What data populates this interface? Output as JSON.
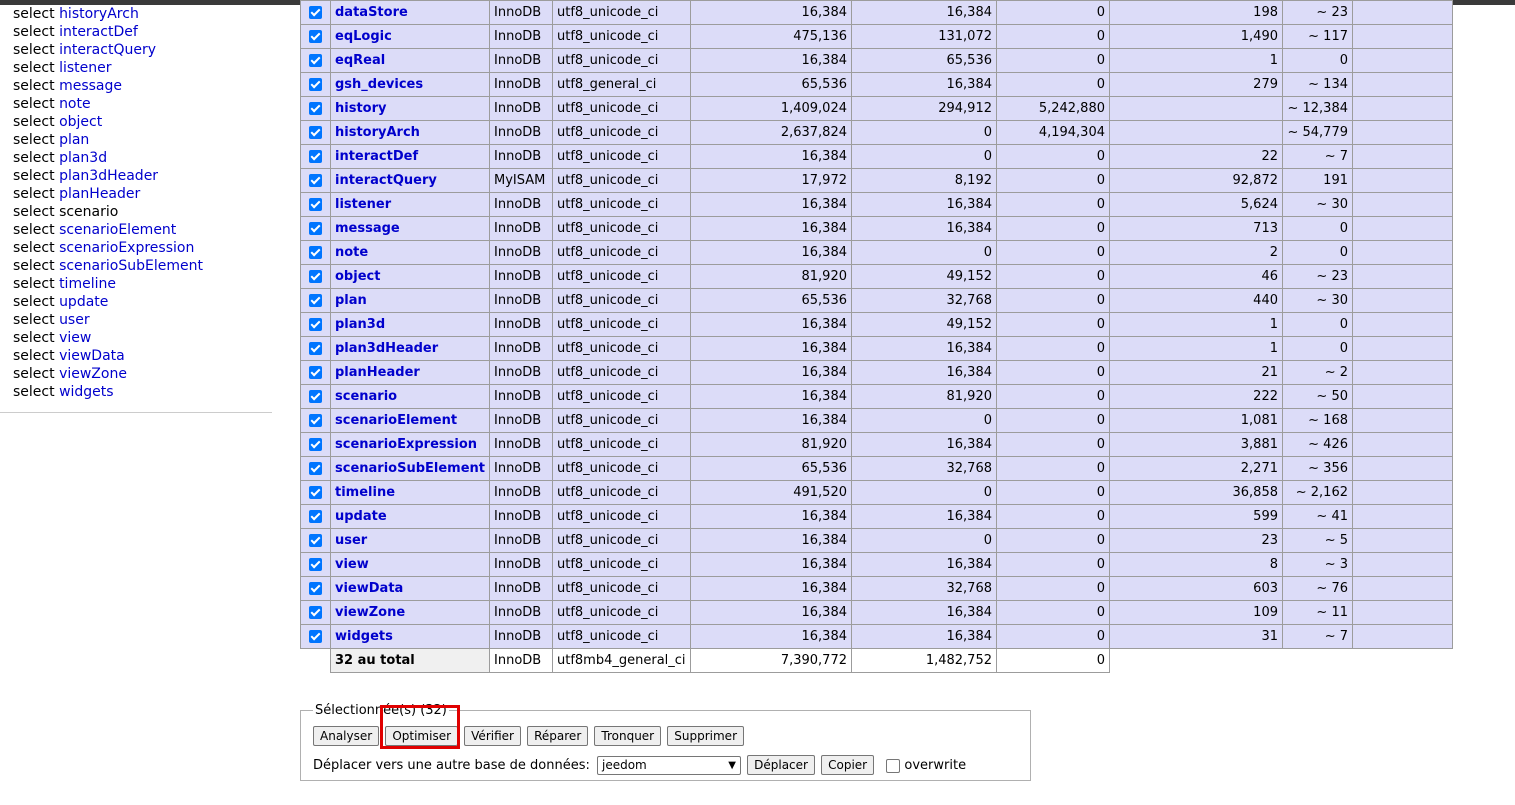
{
  "sidebar": {
    "keyword": "select",
    "items": [
      {
        "name": "historyArch",
        "active": false
      },
      {
        "name": "interactDef",
        "active": false
      },
      {
        "name": "interactQuery",
        "active": false
      },
      {
        "name": "listener",
        "active": false
      },
      {
        "name": "message",
        "active": false
      },
      {
        "name": "note",
        "active": false
      },
      {
        "name": "object",
        "active": false
      },
      {
        "name": "plan",
        "active": false
      },
      {
        "name": "plan3d",
        "active": false
      },
      {
        "name": "plan3dHeader",
        "active": false
      },
      {
        "name": "planHeader",
        "active": false
      },
      {
        "name": "scenario",
        "active": true
      },
      {
        "name": "scenarioElement",
        "active": false
      },
      {
        "name": "scenarioExpression",
        "active": false
      },
      {
        "name": "scenarioSubElement",
        "active": false
      },
      {
        "name": "timeline",
        "active": false
      },
      {
        "name": "update",
        "active": false
      },
      {
        "name": "user",
        "active": false
      },
      {
        "name": "view",
        "active": false
      },
      {
        "name": "viewData",
        "active": false
      },
      {
        "name": "viewZone",
        "active": false
      },
      {
        "name": "widgets",
        "active": false
      }
    ]
  },
  "tables": {
    "rows": [
      {
        "name": "dataStore",
        "engine": "InnoDB",
        "collation": "utf8_unicode_ci",
        "data_length": "16,384",
        "index_length": "16,384",
        "data_free": "0",
        "auto_increment": "198",
        "rows": "~ 23"
      },
      {
        "name": "eqLogic",
        "engine": "InnoDB",
        "collation": "utf8_unicode_ci",
        "data_length": "475,136",
        "index_length": "131,072",
        "data_free": "0",
        "auto_increment": "1,490",
        "rows": "~ 117"
      },
      {
        "name": "eqReal",
        "engine": "InnoDB",
        "collation": "utf8_unicode_ci",
        "data_length": "16,384",
        "index_length": "65,536",
        "data_free": "0",
        "auto_increment": "1",
        "rows": "0"
      },
      {
        "name": "gsh_devices",
        "engine": "InnoDB",
        "collation": "utf8_general_ci",
        "data_length": "65,536",
        "index_length": "16,384",
        "data_free": "0",
        "auto_increment": "279",
        "rows": "~ 134"
      },
      {
        "name": "history",
        "engine": "InnoDB",
        "collation": "utf8_unicode_ci",
        "data_length": "1,409,024",
        "index_length": "294,912",
        "data_free": "5,242,880",
        "auto_increment": "",
        "rows": "~ 12,384"
      },
      {
        "name": "historyArch",
        "engine": "InnoDB",
        "collation": "utf8_unicode_ci",
        "data_length": "2,637,824",
        "index_length": "0",
        "data_free": "4,194,304",
        "auto_increment": "",
        "rows": "~ 54,779"
      },
      {
        "name": "interactDef",
        "engine": "InnoDB",
        "collation": "utf8_unicode_ci",
        "data_length": "16,384",
        "index_length": "0",
        "data_free": "0",
        "auto_increment": "22",
        "rows": "~ 7"
      },
      {
        "name": "interactQuery",
        "engine": "MyISAM",
        "collation": "utf8_unicode_ci",
        "data_length": "17,972",
        "index_length": "8,192",
        "data_free": "0",
        "auto_increment": "92,872",
        "rows": "191"
      },
      {
        "name": "listener",
        "engine": "InnoDB",
        "collation": "utf8_unicode_ci",
        "data_length": "16,384",
        "index_length": "16,384",
        "data_free": "0",
        "auto_increment": "5,624",
        "rows": "~ 30"
      },
      {
        "name": "message",
        "engine": "InnoDB",
        "collation": "utf8_unicode_ci",
        "data_length": "16,384",
        "index_length": "16,384",
        "data_free": "0",
        "auto_increment": "713",
        "rows": "0"
      },
      {
        "name": "note",
        "engine": "InnoDB",
        "collation": "utf8_unicode_ci",
        "data_length": "16,384",
        "index_length": "0",
        "data_free": "0",
        "auto_increment": "2",
        "rows": "0"
      },
      {
        "name": "object",
        "engine": "InnoDB",
        "collation": "utf8_unicode_ci",
        "data_length": "81,920",
        "index_length": "49,152",
        "data_free": "0",
        "auto_increment": "46",
        "rows": "~ 23"
      },
      {
        "name": "plan",
        "engine": "InnoDB",
        "collation": "utf8_unicode_ci",
        "data_length": "65,536",
        "index_length": "32,768",
        "data_free": "0",
        "auto_increment": "440",
        "rows": "~ 30"
      },
      {
        "name": "plan3d",
        "engine": "InnoDB",
        "collation": "utf8_unicode_ci",
        "data_length": "16,384",
        "index_length": "49,152",
        "data_free": "0",
        "auto_increment": "1",
        "rows": "0"
      },
      {
        "name": "plan3dHeader",
        "engine": "InnoDB",
        "collation": "utf8_unicode_ci",
        "data_length": "16,384",
        "index_length": "16,384",
        "data_free": "0",
        "auto_increment": "1",
        "rows": "0"
      },
      {
        "name": "planHeader",
        "engine": "InnoDB",
        "collation": "utf8_unicode_ci",
        "data_length": "16,384",
        "index_length": "16,384",
        "data_free": "0",
        "auto_increment": "21",
        "rows": "~ 2"
      },
      {
        "name": "scenario",
        "engine": "InnoDB",
        "collation": "utf8_unicode_ci",
        "data_length": "16,384",
        "index_length": "81,920",
        "data_free": "0",
        "auto_increment": "222",
        "rows": "~ 50"
      },
      {
        "name": "scenarioElement",
        "engine": "InnoDB",
        "collation": "utf8_unicode_ci",
        "data_length": "16,384",
        "index_length": "0",
        "data_free": "0",
        "auto_increment": "1,081",
        "rows": "~ 168"
      },
      {
        "name": "scenarioExpression",
        "engine": "InnoDB",
        "collation": "utf8_unicode_ci",
        "data_length": "81,920",
        "index_length": "16,384",
        "data_free": "0",
        "auto_increment": "3,881",
        "rows": "~ 426"
      },
      {
        "name": "scenarioSubElement",
        "engine": "InnoDB",
        "collation": "utf8_unicode_ci",
        "data_length": "65,536",
        "index_length": "32,768",
        "data_free": "0",
        "auto_increment": "2,271",
        "rows": "~ 356"
      },
      {
        "name": "timeline",
        "engine": "InnoDB",
        "collation": "utf8_unicode_ci",
        "data_length": "491,520",
        "index_length": "0",
        "data_free": "0",
        "auto_increment": "36,858",
        "rows": "~ 2,162"
      },
      {
        "name": "update",
        "engine": "InnoDB",
        "collation": "utf8_unicode_ci",
        "data_length": "16,384",
        "index_length": "16,384",
        "data_free": "0",
        "auto_increment": "599",
        "rows": "~ 41"
      },
      {
        "name": "user",
        "engine": "InnoDB",
        "collation": "utf8_unicode_ci",
        "data_length": "16,384",
        "index_length": "0",
        "data_free": "0",
        "auto_increment": "23",
        "rows": "~ 5"
      },
      {
        "name": "view",
        "engine": "InnoDB",
        "collation": "utf8_unicode_ci",
        "data_length": "16,384",
        "index_length": "16,384",
        "data_free": "0",
        "auto_increment": "8",
        "rows": "~ 3"
      },
      {
        "name": "viewData",
        "engine": "InnoDB",
        "collation": "utf8_unicode_ci",
        "data_length": "16,384",
        "index_length": "32,768",
        "data_free": "0",
        "auto_increment": "603",
        "rows": "~ 76"
      },
      {
        "name": "viewZone",
        "engine": "InnoDB",
        "collation": "utf8_unicode_ci",
        "data_length": "16,384",
        "index_length": "16,384",
        "data_free": "0",
        "auto_increment": "109",
        "rows": "~ 11"
      },
      {
        "name": "widgets",
        "engine": "InnoDB",
        "collation": "utf8_unicode_ci",
        "data_length": "16,384",
        "index_length": "16,384",
        "data_free": "0",
        "auto_increment": "31",
        "rows": "~ 7"
      }
    ],
    "total": {
      "label": "32 au total",
      "engine": "InnoDB",
      "collation": "utf8mb4_general_ci",
      "data_length": "7,390,772",
      "index_length": "1,482,752",
      "data_free": "0"
    }
  },
  "selection": {
    "legend": "Sélectionnée(s) (32)",
    "buttons": {
      "analyze": "Analyser",
      "optimize": "Optimiser",
      "check": "Vérifier",
      "repair": "Réparer",
      "truncate": "Tronquer",
      "delete": "Supprimer"
    },
    "move_label": "Déplacer vers une autre base de données:",
    "database_value": "jeedom",
    "move_button": "Déplacer",
    "copy_button": "Copier",
    "overwrite_label": "overwrite",
    "overwrite_checked": false
  },
  "colors": {
    "row_bg": "#dcdcf8",
    "link": "#0000cc",
    "checkbox": "#0075ff",
    "highlight": "#e00000"
  }
}
